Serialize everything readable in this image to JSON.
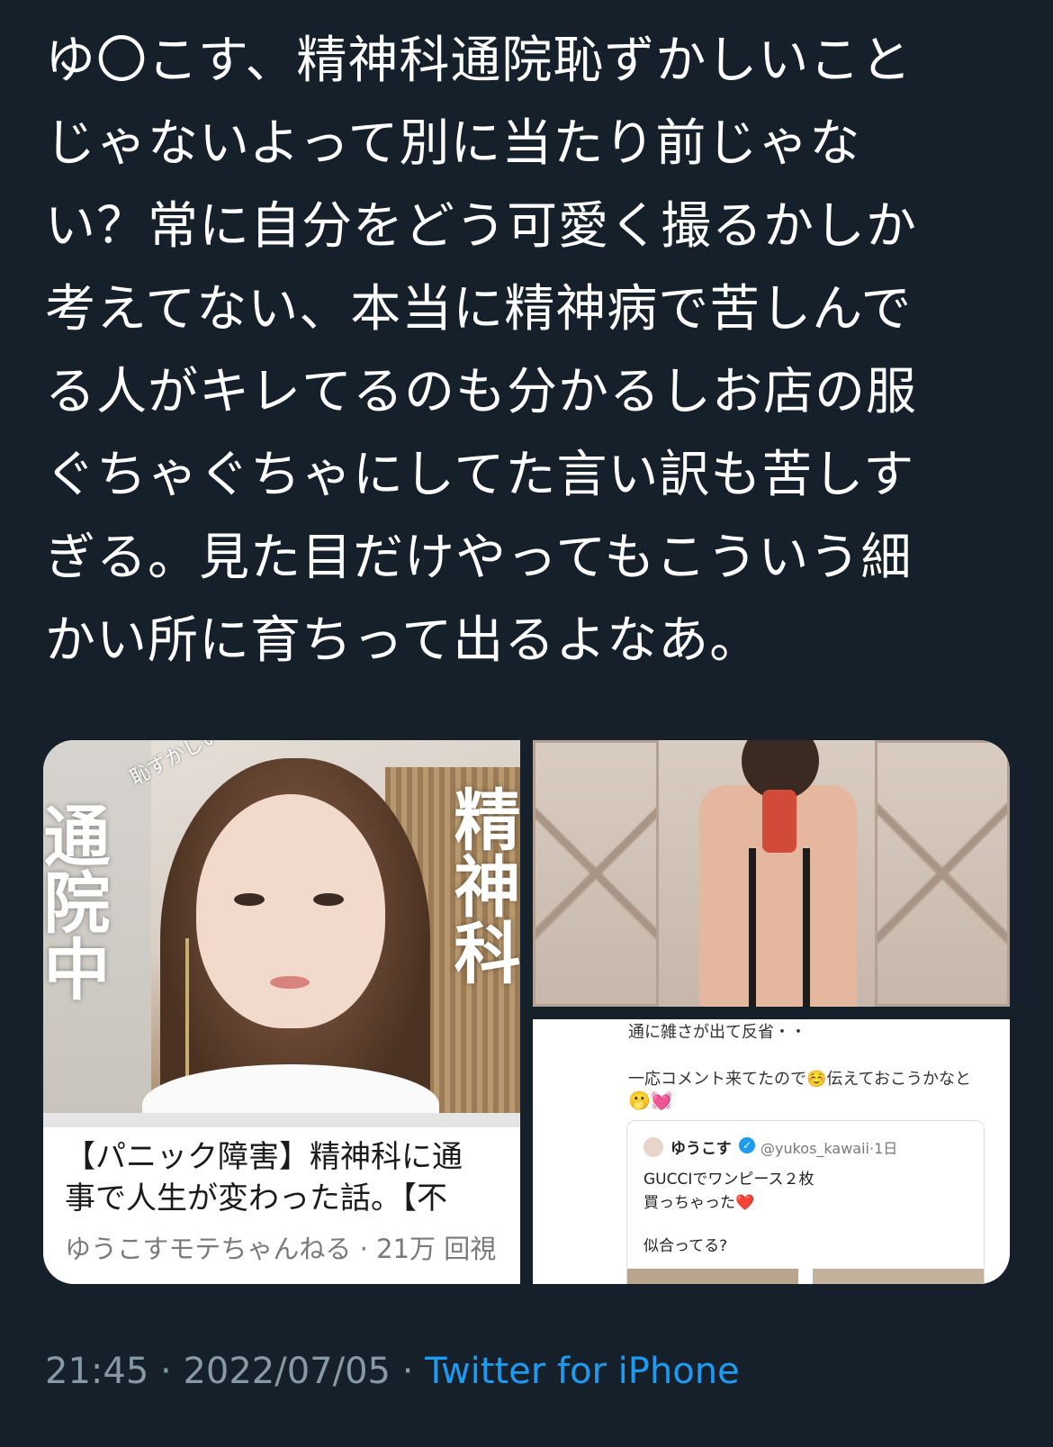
{
  "tweet": {
    "text": "ゆ〇こす、精神科通院恥ずかしいこと\nじゃないよって別に当たり前じゃな\nい？常に自分をどう可愛く撮るかしか\n考えてない、本当に精神病で苦しんで\nる人がキレてるのも分かるしお店の服\nぐちゃぐちゃにしてた言い訳も苦しす\nぎる。見た目だけやってもこういう細\nかい所に育ちって出るよなあ。"
  },
  "video_card": {
    "thumb_left_text": "通院中",
    "thumb_right_text": "精神科",
    "thumb_tag": "恥ずかしい事じゃ無いよ！",
    "title": "【パニック障害】精神科に通\n事で人生が変わった話。【不",
    "meta": "ゆうこすモテちゃんねる · 21万 回視"
  },
  "screenshot": {
    "line1": "通に雑さが出て反省・・",
    "line2": "一応コメント来てたので☺️伝えておこうかなと",
    "emoji_row": "🫢💓",
    "name": "ゆうこす",
    "verified_mark": "✓",
    "handle": "@yukos_kawaii·1日",
    "body1": "GUCCIでワンピース２枚",
    "body2": "買っちゃった",
    "heart": "❤️",
    "body3": "似合ってる?"
  },
  "meta": {
    "time": "21:45",
    "separator": " · ",
    "date": "2022/07/05",
    "source": "Twitter for iPhone"
  },
  "colors": {
    "background": "#15202b",
    "accent": "#1d9bf0",
    "meta_text": "#8899a6"
  }
}
